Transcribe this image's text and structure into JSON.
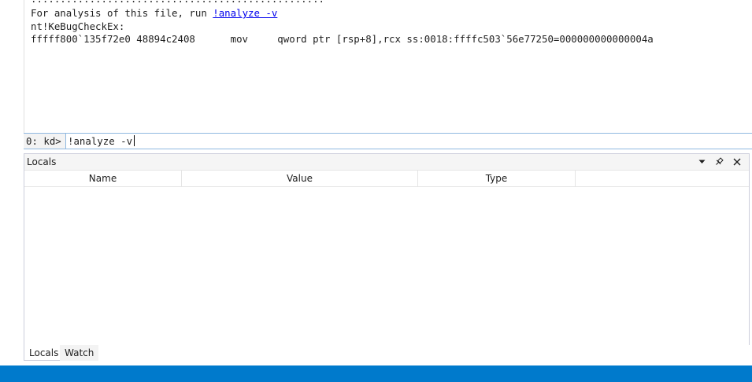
{
  "command_output": {
    "dots": "..................................................",
    "lines": [
      {
        "prefix": "For analysis of this file, run ",
        "link": "!analyze -v"
      },
      {
        "text": "nt!KeBugCheckEx:"
      },
      {
        "text": "fffff800`135f72e0 48894c2408      mov     qword ptr [rsp+8],rcx ss:0018:ffffc503`56e77250=000000000000004a"
      }
    ]
  },
  "prompt": {
    "label": "0: kd>",
    "value": "!analyze -v"
  },
  "locals_panel": {
    "title": "Locals",
    "columns": [
      "Name",
      "Value",
      "Type"
    ]
  },
  "bottom_tabs": [
    {
      "label": "Locals",
      "active": true
    },
    {
      "label": "Watch",
      "active": false
    }
  ],
  "icons": {
    "dropdown": "chevron-down-icon",
    "pin": "pin-icon",
    "close": "close-icon"
  },
  "colors": {
    "status_bar": "#007acc",
    "link": "#0000ee",
    "prompt_border": "#8fb8e0"
  }
}
